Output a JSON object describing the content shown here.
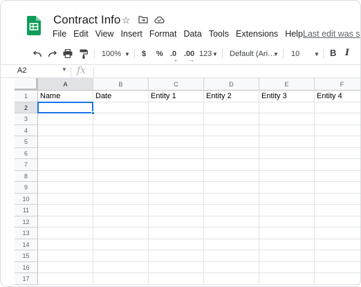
{
  "app": {
    "document_title": "Contract Info",
    "star_icon": "star-icon",
    "move_icon": "folder-move-icon",
    "cloud_icon": "cloud-status-icon"
  },
  "menu": {
    "items": [
      "File",
      "Edit",
      "View",
      "Insert",
      "Format",
      "Data",
      "Tools",
      "Extensions",
      "Help"
    ],
    "last_edit": "Last edit was s"
  },
  "toolbar": {
    "zoom": "100%",
    "currency": "$",
    "percent": "%",
    "decrease_decimal": ".0",
    "increase_decimal": ".00",
    "number_format": "123",
    "font": "Default (Ari…",
    "font_size": "10",
    "bold": "B",
    "italic": "I"
  },
  "formula_bar": {
    "name_box": "A2",
    "fx": "fx",
    "value": ""
  },
  "sheet": {
    "columns": [
      "A",
      "B",
      "C",
      "D",
      "E",
      "F"
    ],
    "rows": [
      "1",
      "2",
      "3",
      "4",
      "5",
      "6",
      "7",
      "8",
      "9",
      "10",
      "11",
      "12",
      "13",
      "14",
      "15",
      "16",
      "17"
    ],
    "row1": [
      "Name",
      "Date",
      "Entity 1",
      "Entity 2",
      "Entity 3",
      "Entity 4"
    ],
    "active_cell": "A2"
  },
  "colors": {
    "accent": "#1a73e8",
    "logo_green": "#0f9d58"
  }
}
